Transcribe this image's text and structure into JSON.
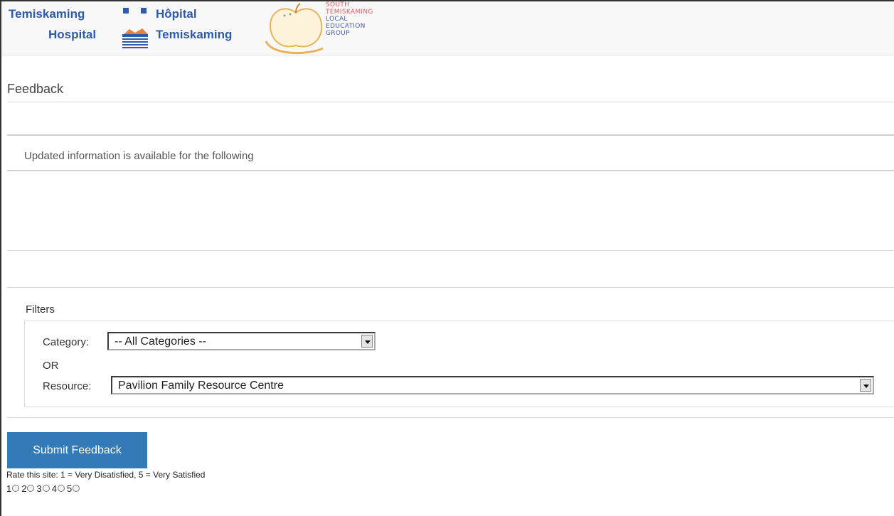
{
  "header": {
    "hospital_logo": {
      "en_line1": "Temiskaming",
      "en_line2": "Hospital",
      "fr_line1": "Hôpital",
      "fr_line2": "Temiskaming"
    },
    "leg_logo": {
      "line1": "SOUTH TEMISKAMING",
      "line2": "LOCAL",
      "line3": "EDUCATION",
      "line4": "GROUP"
    }
  },
  "page": {
    "title": "Feedback",
    "updated_text": "Updated information is available for the following"
  },
  "filters": {
    "label": "Filters",
    "category_label": "Category:",
    "category_value": "-- All Categories --",
    "or_label": "OR",
    "resource_label": "Resource:",
    "resource_value": "Pavilion Family Resource Centre"
  },
  "submit_label": "Submit Feedback",
  "rating": {
    "prompt": "Rate this site: 1 = Very Disatisfied, 5 = Very Satisfied",
    "options": [
      "1",
      "2",
      "3",
      "4",
      "5"
    ]
  },
  "colors": {
    "brand_blue": "#2e5aa8",
    "button_blue": "#337ab7",
    "apple_orange": "#e8b35a"
  }
}
